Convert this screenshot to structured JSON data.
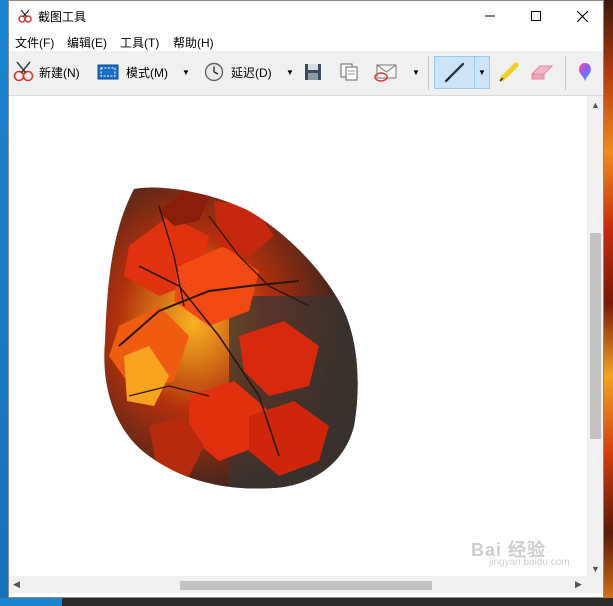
{
  "window": {
    "title": "截图工具",
    "controls": {
      "minimize": "—",
      "maximize": "☐",
      "close": "✕"
    }
  },
  "menubar": {
    "items": [
      "文件(F)",
      "编辑(E)",
      "工具(T)",
      "帮助(H)"
    ]
  },
  "toolbar": {
    "new_label": "新建(N)",
    "mode_label": "模式(M)",
    "delay_label": "延迟(D)",
    "dropdown_arrow": "▼"
  },
  "scroll": {
    "up": "▲",
    "down": "▼",
    "left": "◀",
    "right": "▶"
  },
  "watermark": {
    "text": "Bai 经验",
    "sub": "jingyan.baidu.com"
  },
  "colors": {
    "toolbar_bg": "#f0f0f0",
    "selected_tool": "#cce4f7",
    "leaf_red": "#d9300e",
    "leaf_orange": "#f08a1a"
  }
}
